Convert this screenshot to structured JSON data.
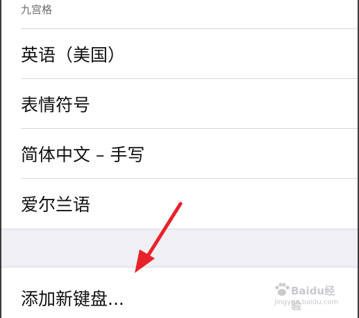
{
  "keyboards": {
    "section_header": "九宫格",
    "items": [
      {
        "label": "英语（美国）"
      },
      {
        "label": "表情符号"
      },
      {
        "label": "简体中文 – 手写"
      },
      {
        "label": "爱尔兰语"
      }
    ],
    "add_keyboard_label": "添加新键盘..."
  },
  "watermark": {
    "brand": "Baidu经验",
    "url": "jingyan.baidu.com"
  },
  "colors": {
    "arrow": "#e8222b",
    "separator": "#d6d6db",
    "group_gap": "#efeff4",
    "text": "#111111"
  },
  "annotations": {
    "arrow_icon": "red-arrow-pointing-to-add-keyboard"
  }
}
